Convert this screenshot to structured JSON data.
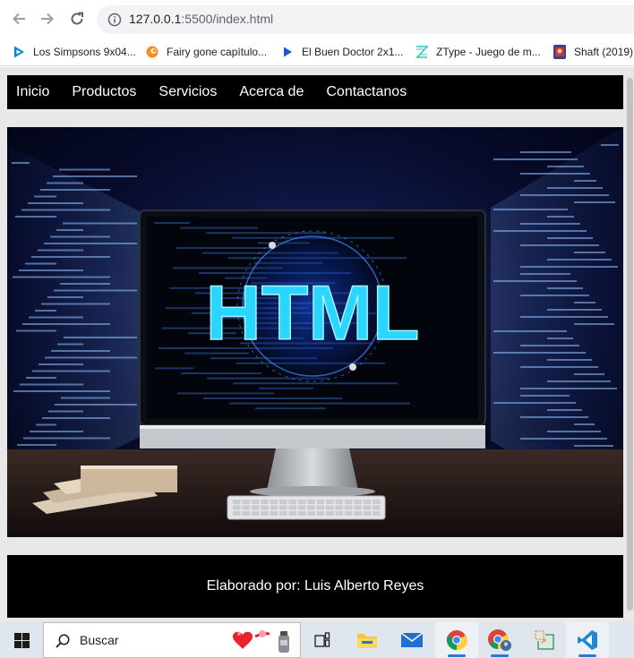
{
  "browser": {
    "url_host": "127.0.0.1",
    "url_path": ":5500/index.html",
    "bookmarks": [
      {
        "label": "Los Simpsons 9x04...",
        "icon": "play-icon"
      },
      {
        "label": "Fairy gone capítulo...",
        "icon": "crunchyroll-icon"
      },
      {
        "label": "El Buen Doctor 2x1...",
        "icon": "play-icon"
      },
      {
        "label": "ZType - Juego de m...",
        "icon": "ztype-icon"
      },
      {
        "label": "Shaft (2019)",
        "icon": "movie-poster-icon"
      }
    ]
  },
  "site": {
    "nav": [
      "Inicio",
      "Productos",
      "Servicios",
      "Acerca de",
      "Contactanos"
    ],
    "hero_text": "HTML",
    "footer": "Elaborado por: Luis Alberto Reyes"
  },
  "taskbar": {
    "search_placeholder": "Buscar",
    "apps": [
      "task-view-icon",
      "file-explorer-icon",
      "mail-icon",
      "chrome-icon",
      "chrome-profile-icon",
      "app-icon",
      "vscode-icon"
    ]
  },
  "colors": {
    "nav_bg": "#000000",
    "nav_text": "#ffffff",
    "page_bg": "#e8e8e8",
    "taskbar_bg": "#dfe6ee",
    "accent": "#2b78d6",
    "hero_glow": "#29d6ff"
  }
}
